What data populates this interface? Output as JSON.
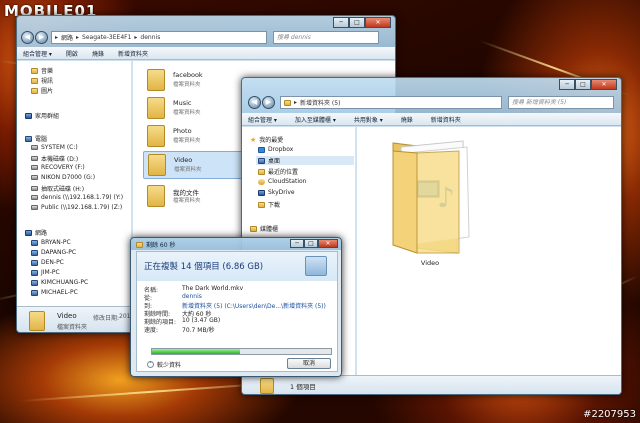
{
  "brand": {
    "logo_text": "MOBILE01"
  },
  "watermark": "#2207953",
  "back_window": {
    "address": [
      "網路",
      "Seagate-3EE4F1",
      "dennis"
    ],
    "search_placeholder": "搜尋 dennis",
    "toolbar": [
      "組合管理 ▾",
      "開啟",
      "燒錄",
      "新增資料夾"
    ],
    "nav": {
      "favorites": [
        "音樂",
        "視訊",
        "圖片"
      ],
      "homegroup": "家用群組",
      "computer": "電腦",
      "drives": [
        "SYSTEM (C:)",
        "本機磁碟 (D:)",
        "RECOVERY (F:)",
        "NIKON D7000 (G:)",
        "抽取式磁碟 (H:)",
        "dennis (\\\\192.168.1.79) (Y:)",
        "Public (\\\\192.168.1.79) (Z:)"
      ],
      "network": "網路",
      "pcs": [
        "BRYAN-PC",
        "DAPANG-PC",
        "DEN-PC",
        "JIM-PC",
        "KIMCHUANG-PC",
        "MICHAEL-PC"
      ]
    },
    "files": [
      {
        "name": "facebook",
        "type": "檔案資料夾"
      },
      {
        "name": "Music",
        "type": "檔案資料夾"
      },
      {
        "name": "Photo",
        "type": "檔案資料夾"
      },
      {
        "name": "Video",
        "type": "檔案資料夾"
      },
      {
        "name": "我的文件",
        "type": "檔案資料夾"
      }
    ],
    "details": {
      "name": "Video",
      "modified_label": "修改日期:",
      "modified_value": "201",
      "type": "檔案資料夾"
    }
  },
  "front_window": {
    "address": "新增資料夾 (5)",
    "search_placeholder": "搜尋 新增資料夾 (5)",
    "toolbar": [
      "組合管理 ▾",
      "加入至媒體櫃 ▾",
      "共用對象 ▾",
      "燒錄",
      "新增資料夾"
    ],
    "nav": {
      "favorites_title": "我的最愛",
      "favorites": [
        "Dropbox",
        "桌面",
        "最近的位置",
        "CloudStation",
        "SkyDrive",
        "下載"
      ],
      "library": "媒體櫃"
    },
    "folder_name": "Video",
    "status_text": "1 個項目"
  },
  "copy_dialog": {
    "title": "剩餘 60 秒",
    "heading": "正在複製 14 個項目 (6.86 GB)",
    "rows": [
      {
        "key": "名稱:",
        "value": "The Dark World.mkv"
      },
      {
        "key": "從:",
        "value": "dennis"
      },
      {
        "key": "到:",
        "value": "新增資料夾 (5) (C:\\Users\\den\\De...\\新增資料夾 (5))"
      },
      {
        "key": "剩餘時間:",
        "value": "大約 60 秒"
      },
      {
        "key": "剩餘的項目:",
        "value": "10 (3.47 GB)"
      },
      {
        "key": "速度:",
        "value": "70.7 MB/秒"
      }
    ],
    "progress": 0.49,
    "less_details": "較少資料",
    "cancel": "取消"
  }
}
